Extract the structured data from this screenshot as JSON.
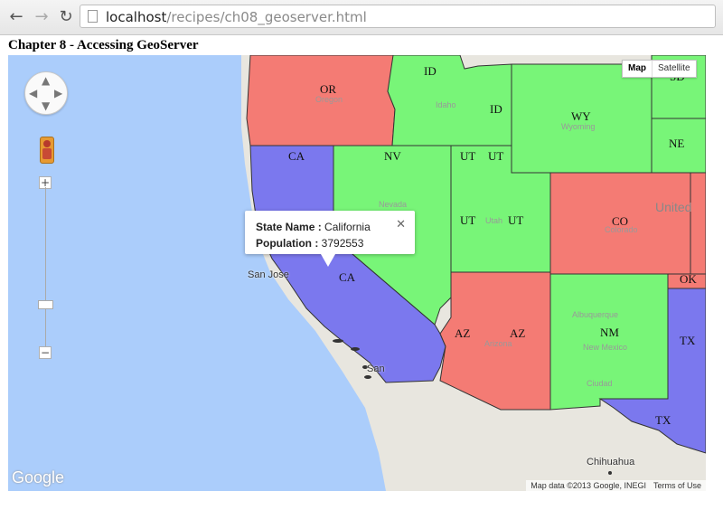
{
  "browser": {
    "url_host": "localhost",
    "url_path": "/recipes/ch08_geoserver.html",
    "back_icon": "back-arrow-icon",
    "forward_icon": "forward-arrow-icon",
    "reload_icon": "reload-icon"
  },
  "page": {
    "title": "Chapter 8 - Accessing GeoServer"
  },
  "map": {
    "map_type": {
      "map_label": "Map",
      "satellite_label": "Satellite",
      "selected": "Map"
    },
    "zoom": {
      "in_label": "+",
      "out_label": "−"
    },
    "popup": {
      "state_name_label": "State Name",
      "state_name_value": "California",
      "population_label": "Population",
      "population_value": "3792553",
      "separator": " : ",
      "close_label": "✕"
    },
    "logo": "Google",
    "attribution": "Map data ©2013 Google, INEGI",
    "terms": "Terms of Use",
    "cities": {
      "san_jose": "San Jose",
      "san": "San",
      "chihuahua": "Chihuahua",
      "united": "United"
    },
    "state_labels": {
      "or": "OR",
      "id1": "ID",
      "id2": "ID",
      "wy": "WY",
      "sd": "SD",
      "ne": "NE",
      "ca1": "CA",
      "ca2": "CA",
      "nv": "NV",
      "ut1": "UT",
      "ut2": "UT",
      "ut3": "UT",
      "ut4": "UT",
      "co": "CO",
      "az1": "AZ",
      "az2": "AZ",
      "nm": "NM",
      "ok": "OK",
      "tx1": "TX",
      "tx2": "TX"
    },
    "basemap_labels": {
      "oregon": "Oregon",
      "idaho": "Idaho",
      "wyoming": "Wyoming",
      "nevada": "Nevada",
      "colorado": "Colorado",
      "utah": "Utah",
      "arizona": "Arizona",
      "new_mexico": "New Mexico",
      "albuquerque": "Albuquerque",
      "ciudad": "Ciudad"
    },
    "colors": {
      "red": "#f47b74",
      "green": "#78f578",
      "blue": "#7b78ee",
      "water": "#abcdfb",
      "land": "#e8e6df"
    }
  }
}
